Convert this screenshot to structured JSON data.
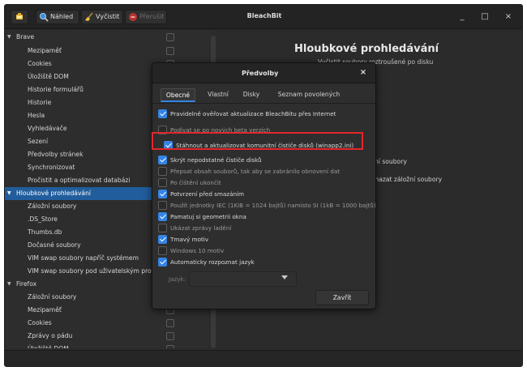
{
  "app": {
    "title": "BleachBit",
    "accent_color": "#3584e4",
    "selection_color": "#215d9c"
  },
  "toolbar": {
    "app_icon": "bleachbit-icon",
    "preview_label": "Náhled",
    "preview_icon": "magnifier-icon",
    "clean_label": "Vyčistit",
    "clean_icon": "broom-icon",
    "abort_label": "Přerušit",
    "abort_icon": "stop-icon"
  },
  "window_controls": {
    "minimize": "_",
    "maximize": "□",
    "close": "×"
  },
  "tree": {
    "rows": [
      {
        "label": "Brave",
        "type": "parent"
      },
      {
        "label": "Mezipaměť",
        "type": "child"
      },
      {
        "label": "Cookies",
        "type": "child"
      },
      {
        "label": "Úložiště DOM",
        "type": "child"
      },
      {
        "label": "Historie formulářů",
        "type": "child"
      },
      {
        "label": "Historie",
        "type": "child"
      },
      {
        "label": "Hesla",
        "type": "child"
      },
      {
        "label": "Vyhledávače",
        "type": "child"
      },
      {
        "label": "Sezení",
        "type": "child"
      },
      {
        "label": "Předvolby stránek",
        "type": "child"
      },
      {
        "label": "Synchronizovat",
        "type": "child"
      },
      {
        "label": "Pročistit a optimalizovat databázi",
        "type": "child"
      },
      {
        "label": "Hloubkové prohledávání",
        "type": "parent",
        "selected": true
      },
      {
        "label": "Záložní soubory",
        "type": "child"
      },
      {
        "label": ".DS_Store",
        "type": "child"
      },
      {
        "label": "Thumbs.db",
        "type": "child"
      },
      {
        "label": "Dočasné soubory",
        "type": "child"
      },
      {
        "label": "VIM swap soubory napříč systémem",
        "type": "child"
      },
      {
        "label": "VIM swap soubory pod uživatelským profilem",
        "type": "child"
      },
      {
        "label": "Firefox",
        "type": "parent"
      },
      {
        "label": "Záložní soubory",
        "type": "child"
      },
      {
        "label": "Mezipaměť",
        "type": "child"
      },
      {
        "label": "Cookies",
        "type": "child"
      },
      {
        "label": "Zprávy o pádu",
        "type": "child"
      },
      {
        "label": "Úložiště DOM",
        "type": "child"
      }
    ]
  },
  "detail": {
    "title": "Hloubkové prohledávání",
    "subtitle": "Vyčistit soubory roztroušené po disku",
    "fragment_1": "žní soubory",
    "fragment_2": "Smazat záložní soubory"
  },
  "dialog": {
    "title": "Předvolby",
    "close_glyph": "×",
    "tabs": [
      "Obecné",
      "Vlastní",
      "Disky",
      "Seznam povolených"
    ],
    "active_tab": 0,
    "options": [
      {
        "label": "Pravidelně ověřovat aktualizace BleachBitu přes Internet",
        "checked": true
      },
      {
        "label": "Podívat se po nových beta verzích",
        "checked": false
      },
      {
        "label": "Stáhnout a aktualizovat komunitní čističe disků (winapp2.ini)",
        "checked": true
      },
      {
        "label": "Skrýt nepodstatné čističe disků",
        "checked": true
      },
      {
        "label": "Přepsat obsah souborů, tak aby se zabránilo obnovení dat",
        "checked": false
      },
      {
        "label": "Po čištění ukončit",
        "checked": false
      },
      {
        "label": "Potvrzení před smazáním",
        "checked": true
      },
      {
        "label": "Použít jednotky IEC (1KiB = 1024 bajtů) namísto SI (1kB = 1000 bajtů)",
        "checked": false
      },
      {
        "label": "Pamatuj si geometrii okna",
        "checked": true
      },
      {
        "label": "Ukázat zprávy ladění",
        "checked": false
      },
      {
        "label": "Tmavý motiv",
        "checked": true
      },
      {
        "label": "Windows 10 motiv",
        "checked": false
      },
      {
        "label": "Automaticky rozpoznat jazyk",
        "checked": true
      }
    ],
    "language_label": "Jazyk:",
    "language_value": "",
    "close_button": "Zavřít",
    "highlight_color": "#e3262b"
  }
}
